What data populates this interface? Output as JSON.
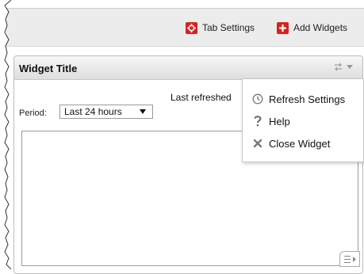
{
  "toolbar": {
    "tab_settings_label": "Tab Settings",
    "add_widgets_label": "Add Widgets",
    "accent_color": "#d8221f"
  },
  "widget": {
    "title": "Widget Title",
    "last_refreshed_label": "Last refreshed",
    "period_label": "Period:",
    "period_value": "Last 24 hours"
  },
  "menu": {
    "items": [
      {
        "label": "Refresh Settings",
        "icon": "clock-icon"
      },
      {
        "label": "Help",
        "icon": "question-mark-icon"
      },
      {
        "label": "Close Widget",
        "icon": "close-x-icon"
      }
    ]
  }
}
